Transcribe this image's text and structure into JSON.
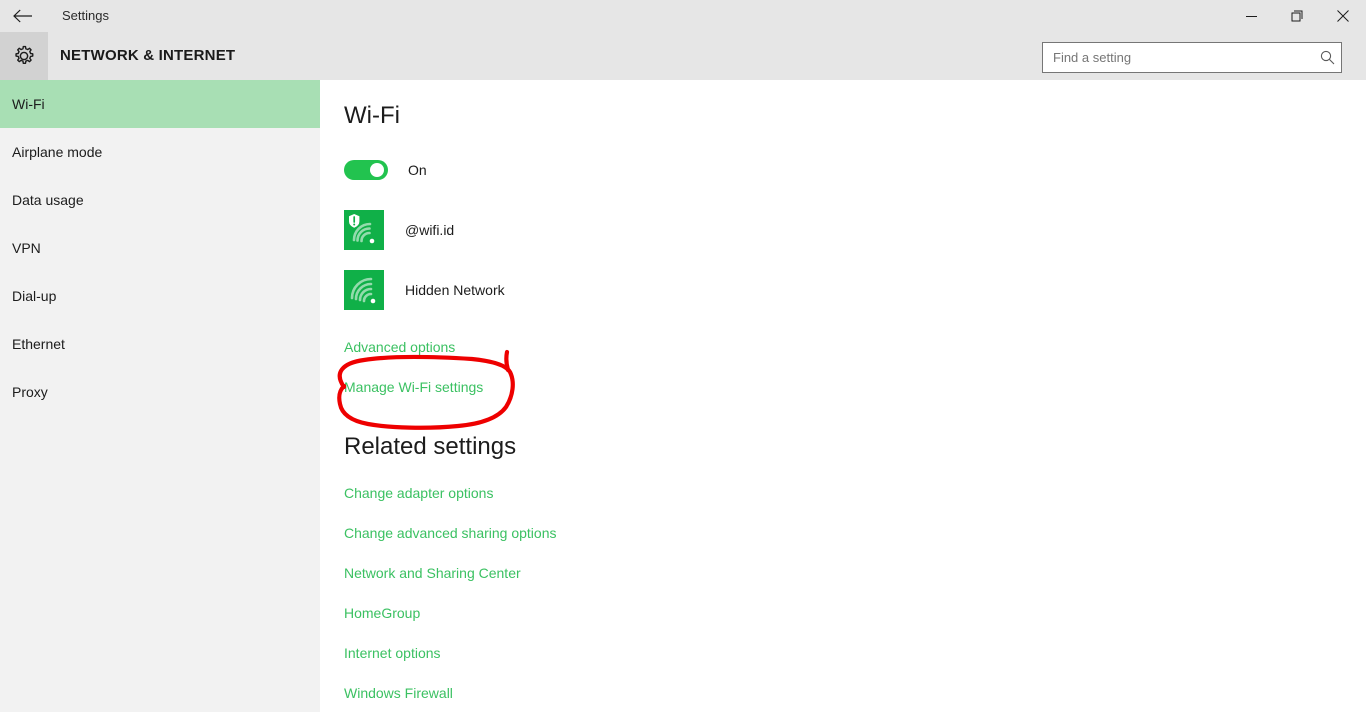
{
  "window": {
    "title": "Settings",
    "back_icon": "back-arrow-icon",
    "minimize_label": "—",
    "maximize_label": "❐",
    "close_label": "✕"
  },
  "header": {
    "icon": "gear-icon",
    "title": "NETWORK & INTERNET",
    "search": {
      "placeholder": "Find a setting",
      "value": "",
      "icon": "search-icon"
    }
  },
  "sidebar": {
    "items": [
      {
        "label": "Wi-Fi",
        "active": true
      },
      {
        "label": "Airplane mode",
        "active": false
      },
      {
        "label": "Data usage",
        "active": false
      },
      {
        "label": "VPN",
        "active": false
      },
      {
        "label": "Dial-up",
        "active": false
      },
      {
        "label": "Ethernet",
        "active": false
      },
      {
        "label": "Proxy",
        "active": false
      }
    ],
    "active_color": "#a8dfb4",
    "background": "#f2f2f2"
  },
  "main": {
    "title": "Wi-Fi",
    "toggle": {
      "state_label": "On",
      "on": true,
      "color": "#22c34f"
    },
    "networks": [
      {
        "name": "@wifi.id",
        "icon": "wifi-insecure-icon",
        "secured": false
      },
      {
        "name": "Hidden Network",
        "icon": "wifi-icon",
        "secured": true
      }
    ],
    "links": [
      {
        "label": "Advanced options"
      },
      {
        "label": "Manage Wi-Fi settings"
      }
    ],
    "related": {
      "title": "Related settings",
      "links": [
        {
          "label": "Change adapter options"
        },
        {
          "label": "Change advanced sharing options"
        },
        {
          "label": "Network and Sharing Center"
        },
        {
          "label": "HomeGroup"
        },
        {
          "label": "Internet options"
        },
        {
          "label": "Windows Firewall"
        }
      ]
    },
    "link_color": "#3bc162"
  },
  "annotation": {
    "type": "hand-drawn-ellipse",
    "color": "#ee0000",
    "target": "Manage Wi-Fi settings"
  }
}
